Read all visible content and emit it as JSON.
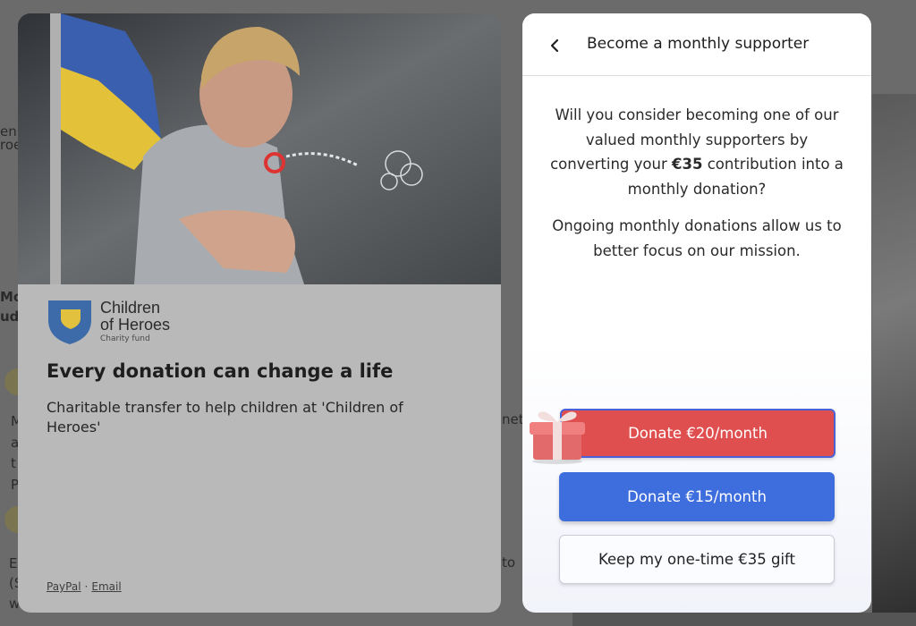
{
  "background": {
    "fragments": [
      "en",
      "roe",
      "Mo",
      "udj",
      "M",
      "a",
      "t",
      "P",
      "E",
      "(S",
      "w",
      "net",
      "to"
    ]
  },
  "campaign": {
    "hero_icon": "hero-photo-child-with-bubbles",
    "brand_name": "Children of Heroes",
    "brand_name_line1": "Children",
    "brand_name_line2": "of Heroes",
    "brand_tagline": "Charity fund",
    "title": "Every donation can change a life",
    "description": "Charitable transfer to help children at 'Children of Heroes'",
    "footer_links": [
      "PayPal",
      "Email"
    ],
    "footer_separator": "·"
  },
  "modal": {
    "back_icon": "chevron-left-icon",
    "title": "Become a monthly supporter",
    "body_part1": "Will you consider becoming one of our valued monthly supporters by converting your ",
    "body_amount": "€35",
    "body_part2": " contribution into a monthly donation?",
    "body_para2": "Ongoing monthly donations allow us to better focus on our mission.",
    "gift_icon": "gift-icon",
    "buttons": {
      "donate_20": "Donate €20/month",
      "donate_15": "Donate €15/month",
      "keep_gift": "Keep my one-time €35 gift"
    },
    "colors": {
      "donate_20_bg": "#e04f4f",
      "donate_15_bg": "#3e6ddd",
      "selected_border": "#4b62d6"
    }
  }
}
